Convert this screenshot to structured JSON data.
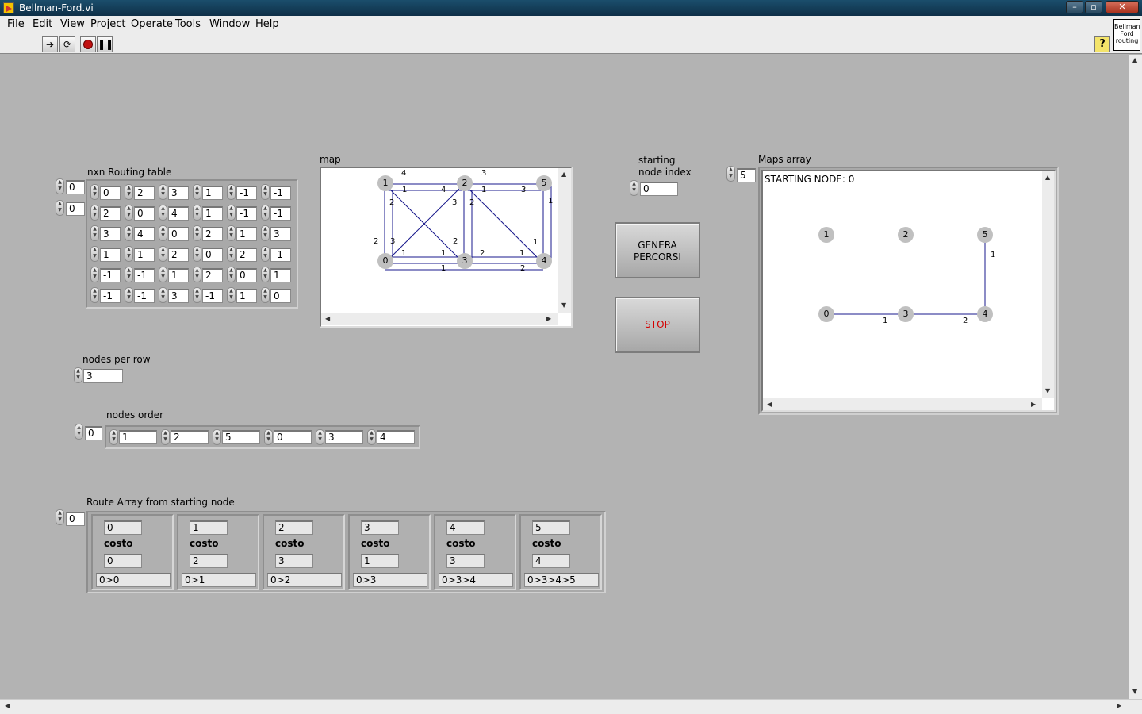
{
  "window": {
    "title": "Bellman-Ford.vi"
  },
  "menu": [
    "File",
    "Edit",
    "View",
    "Project",
    "Operate",
    "Tools",
    "Window",
    "Help"
  ],
  "vi_icon": {
    "lines": [
      "Bellman",
      "Ford",
      "routing"
    ]
  },
  "icons": {
    "run": "run-arrow-icon",
    "run_cont": "run-continuously-icon",
    "abort": "abort-icon",
    "pause": "pause-icon",
    "help": "help-icon"
  },
  "routing_table": {
    "label": "nxn Routing table",
    "row_index": "0",
    "col_index": "0",
    "rows": [
      [
        "0",
        "2",
        "3",
        "1",
        "-1",
        "-1"
      ],
      [
        "2",
        "0",
        "4",
        "1",
        "-1",
        "-1"
      ],
      [
        "3",
        "4",
        "0",
        "2",
        "1",
        "3"
      ],
      [
        "1",
        "1",
        "2",
        "0",
        "2",
        "-1"
      ],
      [
        "-1",
        "-1",
        "1",
        "2",
        "0",
        "1"
      ],
      [
        "-1",
        "-1",
        "3",
        "-1",
        "1",
        "0"
      ]
    ]
  },
  "map": {
    "label": "map",
    "nodes": [
      "1",
      "2",
      "5",
      "0",
      "3",
      "4"
    ],
    "edge_labels": [
      "4",
      "3",
      "1",
      "1",
      "3",
      "1",
      "2",
      "3",
      "2",
      "4",
      "1",
      "2",
      "3",
      "2",
      "1",
      "1",
      "1",
      "2",
      "1",
      "2"
    ]
  },
  "starting_node": {
    "label_line1": "starting",
    "label_line2": "node index",
    "value": "0"
  },
  "buttons": {
    "genera_line1": "GENERA",
    "genera_line2": "PERCORSI",
    "stop": "STOP"
  },
  "maps_array": {
    "label": "Maps array",
    "index": "5",
    "header": "STARTING NODE: 0",
    "nodes": [
      "1",
      "2",
      "5",
      "0",
      "3",
      "4"
    ],
    "edge_labels": [
      "1",
      "1",
      "2"
    ]
  },
  "nodes_per_row": {
    "label": "nodes per row",
    "value": "3"
  },
  "nodes_order": {
    "label": "nodes order",
    "index": "0",
    "values": [
      "1",
      "2",
      "5",
      "0",
      "3",
      "4"
    ]
  },
  "route_array": {
    "label": "Route Array from starting node",
    "index": "0",
    "cost_label": "costo",
    "items": [
      {
        "node": "0",
        "cost": "0",
        "path": "0>0"
      },
      {
        "node": "1",
        "cost": "2",
        "path": "0>1"
      },
      {
        "node": "2",
        "cost": "3",
        "path": "0>2"
      },
      {
        "node": "3",
        "cost": "1",
        "path": "0>3"
      },
      {
        "node": "4",
        "cost": "3",
        "path": "0>3>4"
      },
      {
        "node": "5",
        "cost": "4",
        "path": "0>3>4>5"
      }
    ]
  },
  "colors": {
    "panel": "#b3b3b3",
    "edge": "#1a1a8c",
    "node": "#c0c0c0",
    "stop_text": "#d40000"
  }
}
